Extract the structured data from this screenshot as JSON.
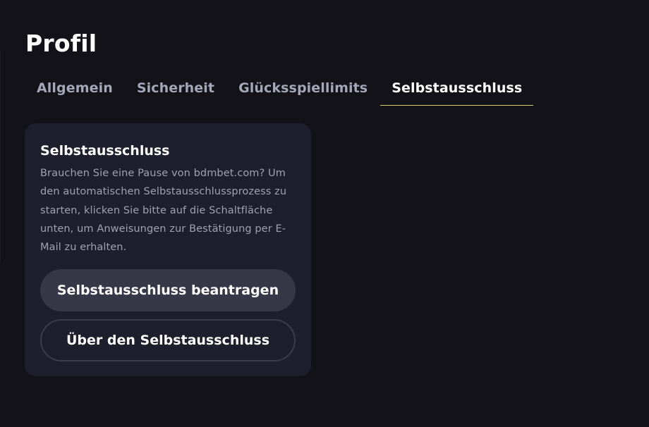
{
  "page": {
    "title": "Profil"
  },
  "tabs": [
    {
      "label": "Allgemein",
      "active": false
    },
    {
      "label": "Sicherheit",
      "active": false
    },
    {
      "label": "Glücksspiellimits",
      "active": false
    },
    {
      "label": "Selbstausschluss",
      "active": true
    }
  ],
  "card": {
    "title": "Selbstausschluss",
    "description": "Brauchen Sie eine Pause von bdmbet.com? Um den automatischen Selbstausschlussprozess zu starten, klicken Sie bitte auf die Schaltfläche unten, um Anweisungen zur Bestätigung per E-Mail zu erhalten.",
    "primary_button": "Selbstausschluss beantragen",
    "secondary_button": "Über den Selbstausschluss"
  },
  "colors": {
    "background": "#121218",
    "card": "#1e1e2c",
    "active_tab_underline": "#d8d26a",
    "inactive_tab_text": "#a5a7b8",
    "primary_button": "#363848"
  }
}
